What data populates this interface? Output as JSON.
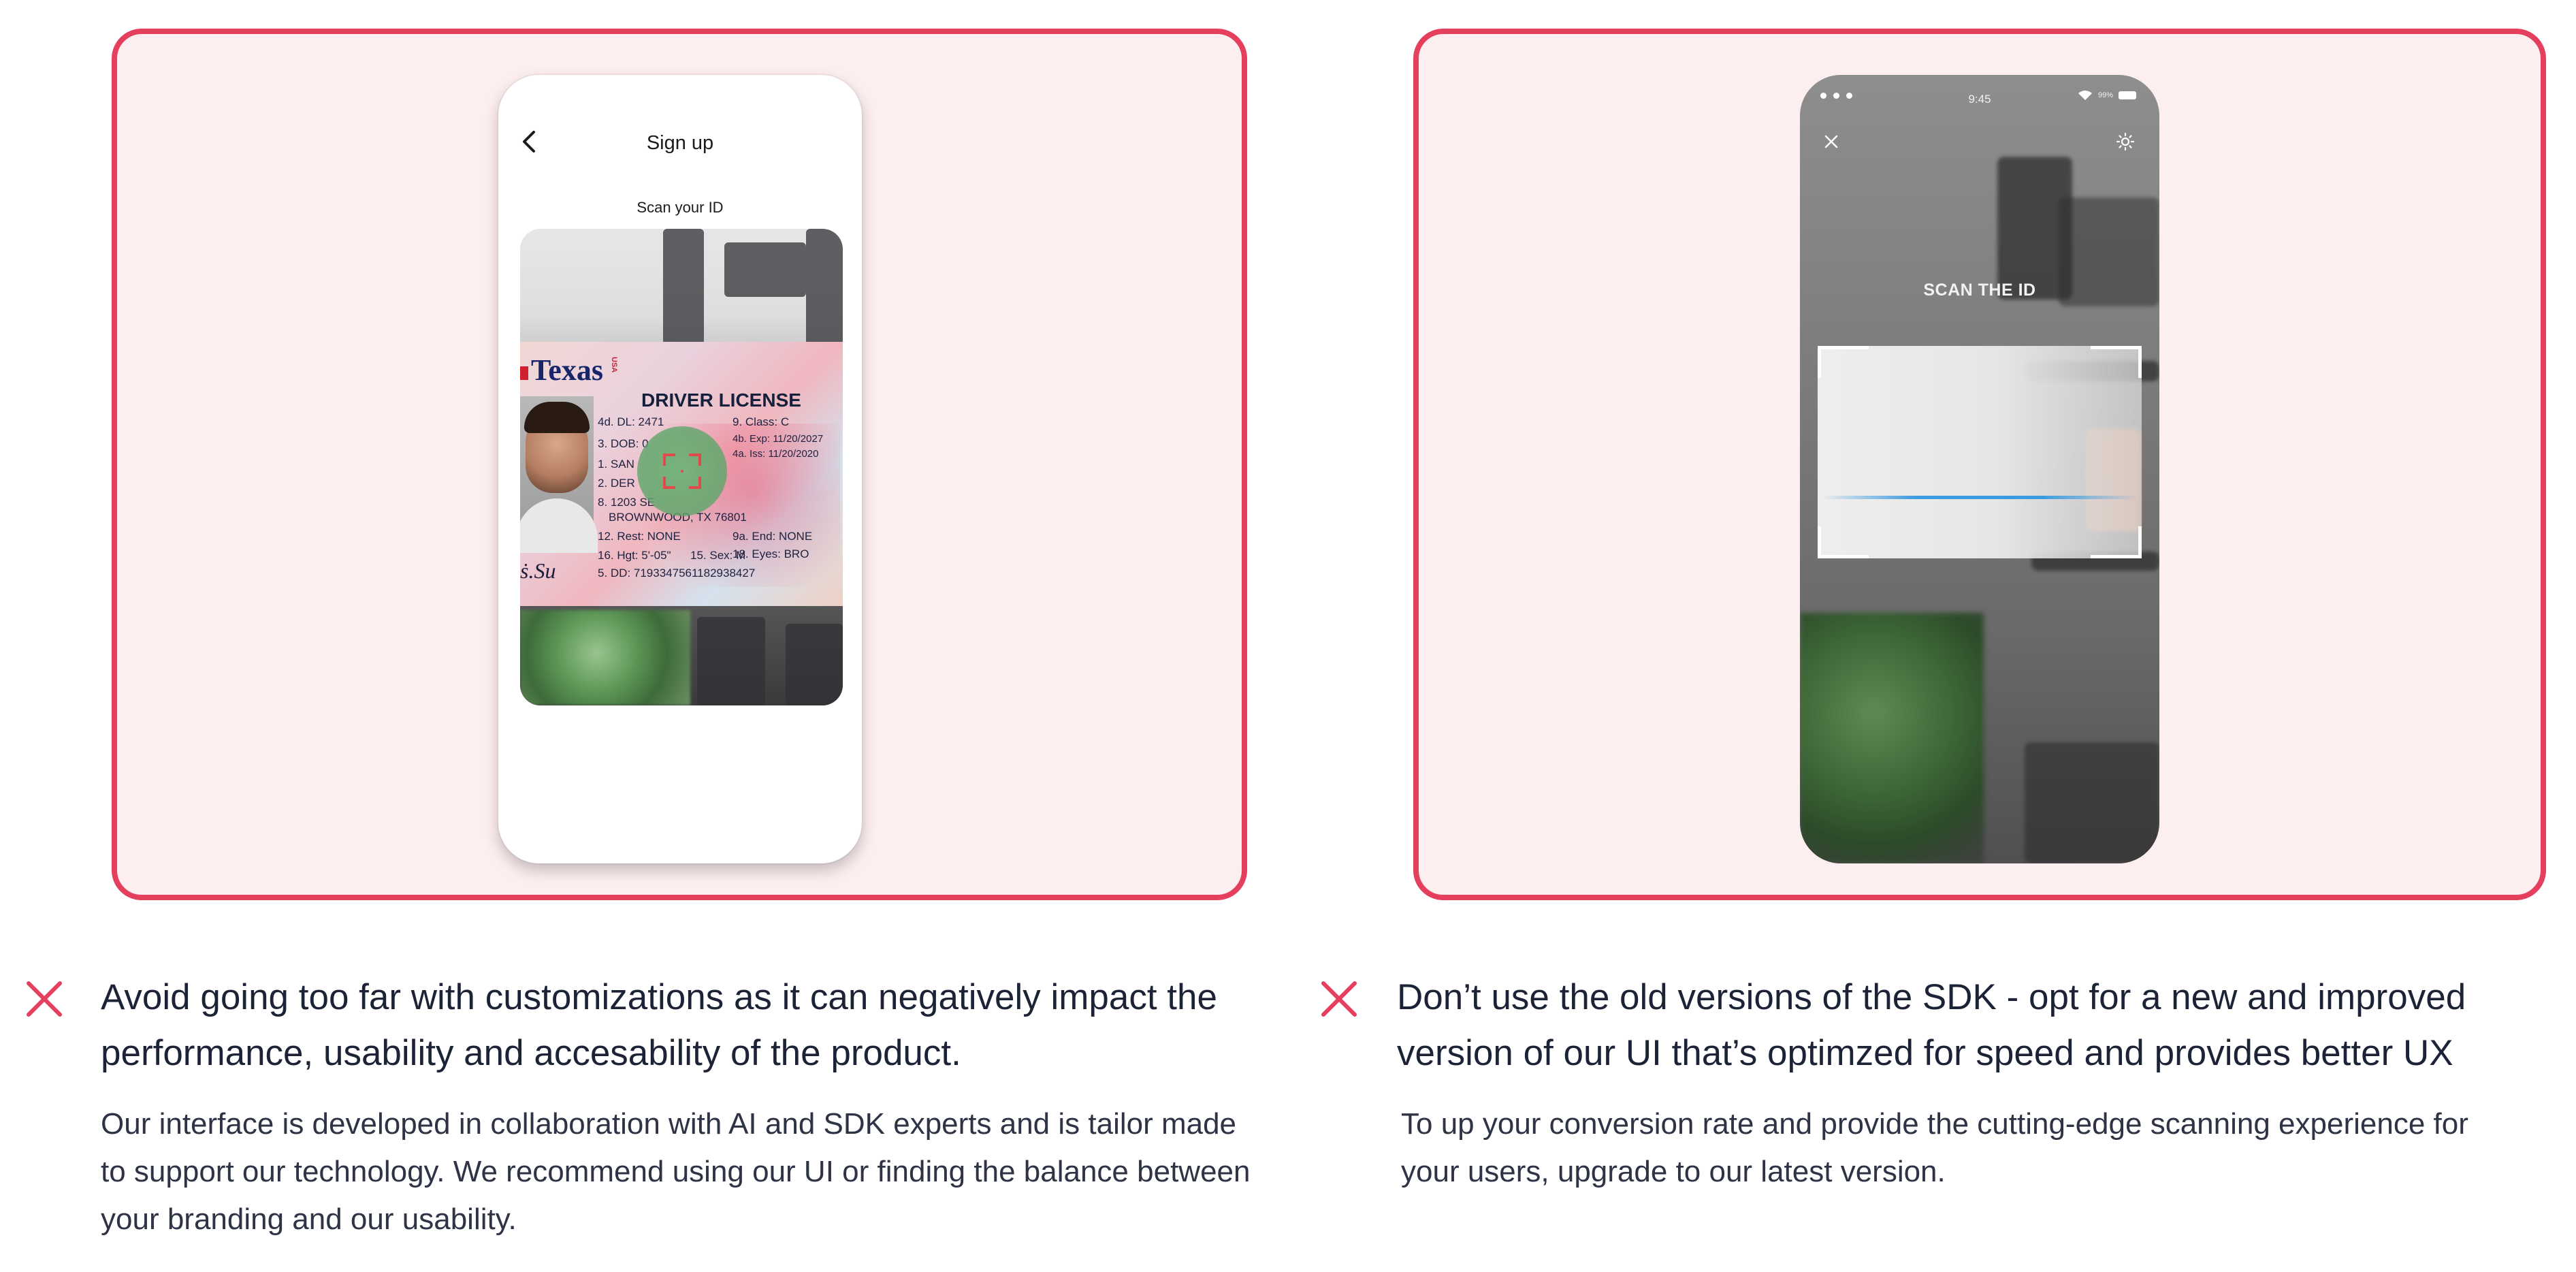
{
  "colors": {
    "accent": "#e4405e",
    "panel_background": "#fdeef0",
    "text_dark": "#1d2336",
    "scan_line": "#3b9be0"
  },
  "left_example": {
    "phone": {
      "screen_title": "Sign up",
      "instruction": "Scan your ID",
      "back_icon": "chevron-left-icon",
      "id_card": {
        "state": "Texas",
        "country": "USA",
        "doc_type": "DRIVER LICENSE",
        "lines": {
          "dl": "4d. DL: 2471",
          "dob": "3. DOB: 0",
          "name1": "1. SAN",
          "name2": "2. DER",
          "address": "8. 1203 SE",
          "city": "BROWNWOOD, TX 76801",
          "restrictions": "12. Rest: NONE",
          "height": "16. Hgt: 5'-05\"",
          "sex": "15. Sex: M",
          "dd": "5. DD: 7193347561182938427",
          "class": "9. Class: C",
          "exp": "4b. Exp: 11/20/2027",
          "iss": "4a. Iss: 11/20/2020",
          "endorsements": "9a. End: NONE",
          "eyes": "18. Eyes: BRO"
        }
      }
    },
    "cross_icon": "x-mark-icon",
    "heading": "Avoid going too far with customizations as it can negatively impact the performance, usability and accesability of the product.",
    "body": "Our interface is developed in collaboration with AI and SDK experts and is tailor made to support our technology. We recommend using our UI or finding the balance between your branding and our usability."
  },
  "right_example": {
    "phone": {
      "status_time": "9:45",
      "battery_text": "99%",
      "close_icon": "close-icon",
      "brightness_icon": "sun-icon",
      "scan_title": "SCAN THE ID"
    },
    "cross_icon": "x-mark-icon",
    "heading": "Don’t use the old versions of the SDK - opt for a new and improved version of our UI that’s optimzed for speed and provides better UX",
    "body": "To up your conversion rate and provide the cutting-edge scanning experience for your users, upgrade to our latest version."
  }
}
